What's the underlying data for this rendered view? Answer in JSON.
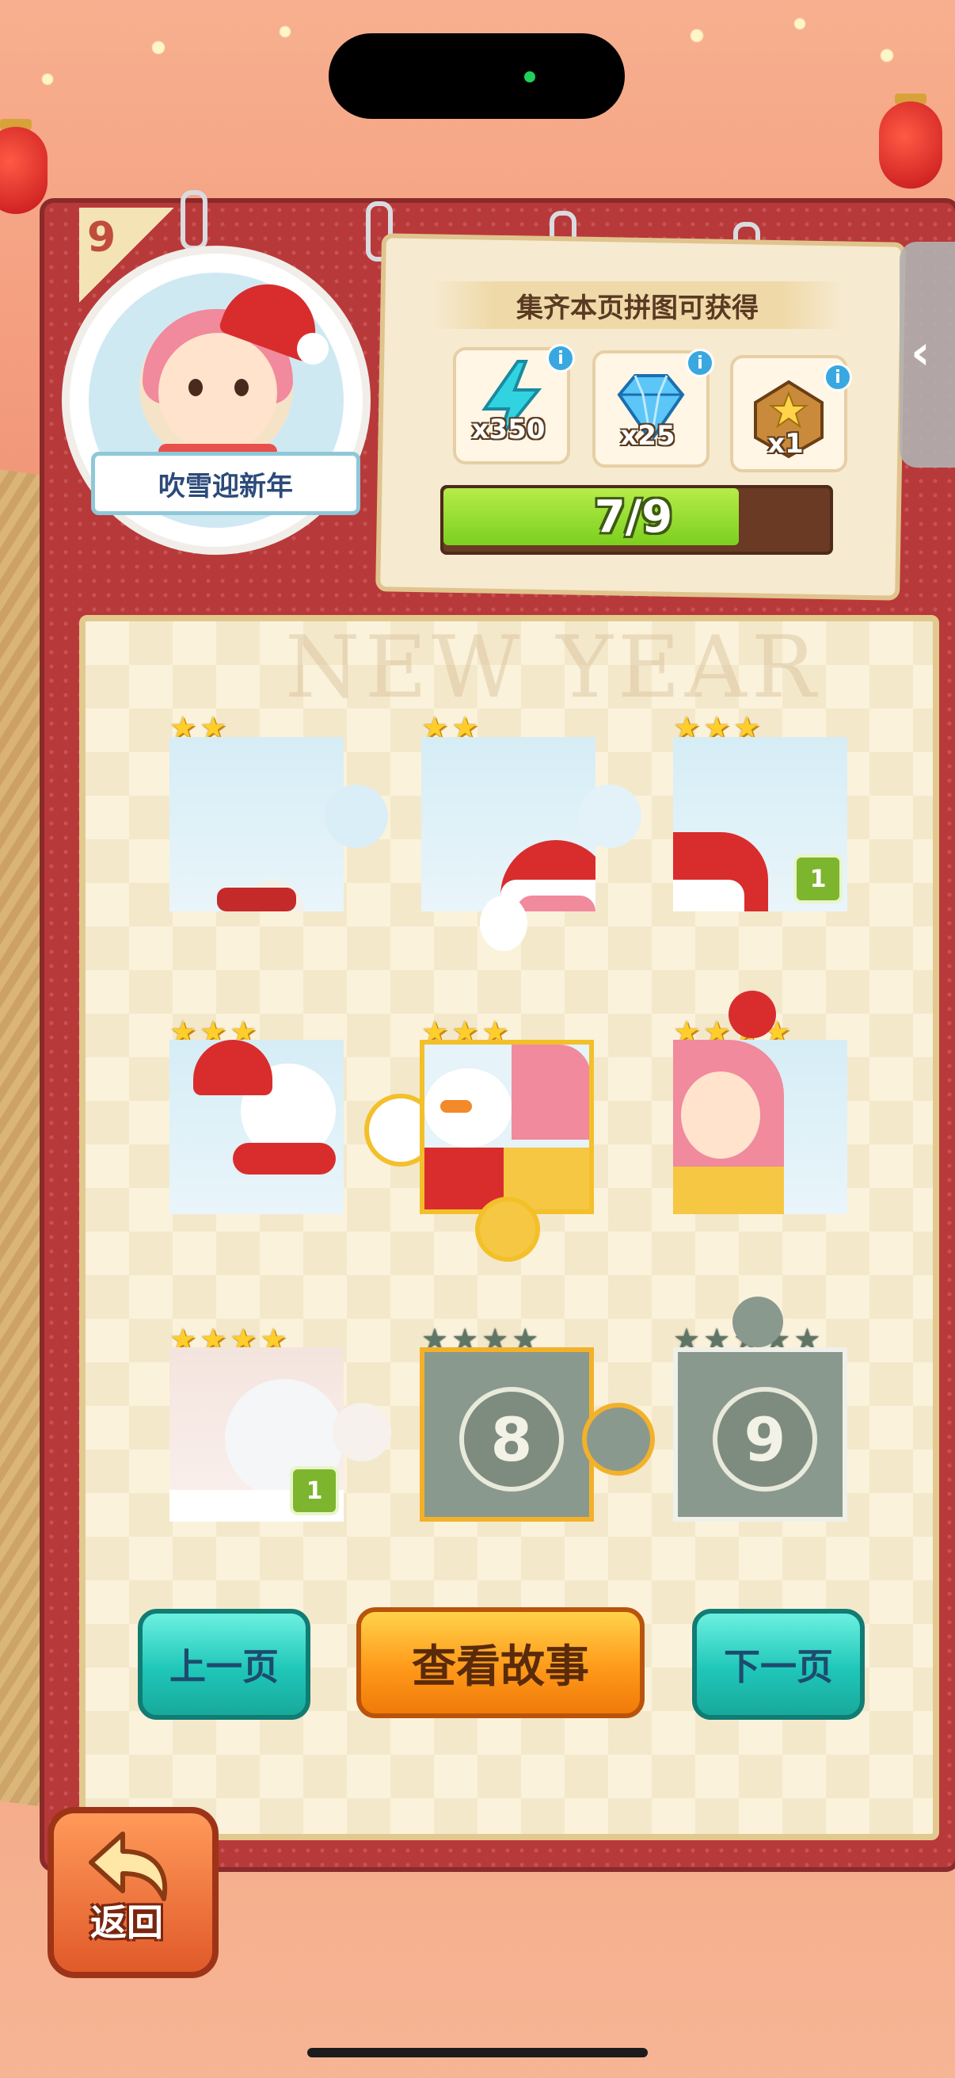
{
  "page_number": "9",
  "badge": {
    "title": "吹雪迎新年"
  },
  "reward_panel": {
    "title": "集齐本页拼图可获得",
    "rewards": [
      {
        "icon": "lightning-icon",
        "qty": "x350"
      },
      {
        "icon": "diamond-icon",
        "qty": "x25"
      },
      {
        "icon": "treasure-chest-icon",
        "qty": "x1"
      }
    ],
    "info_label": "i",
    "progress_text": "7/9",
    "progress_fraction": 0.7778
  },
  "watermark": "NEW YEAR",
  "pieces": [
    {
      "stars": 2,
      "max_stars": 2,
      "locked": false,
      "badge": ""
    },
    {
      "stars": 2,
      "max_stars": 2,
      "locked": false,
      "badge": ""
    },
    {
      "stars": 3,
      "max_stars": 3,
      "locked": false,
      "badge": "1"
    },
    {
      "stars": 3,
      "max_stars": 3,
      "locked": false,
      "badge": ""
    },
    {
      "stars": 3,
      "max_stars": 3,
      "locked": false,
      "badge": ""
    },
    {
      "stars": 4,
      "max_stars": 4,
      "locked": false,
      "badge": ""
    },
    {
      "stars": 4,
      "max_stars": 4,
      "locked": false,
      "badge": "1"
    },
    {
      "stars": 0,
      "max_stars": 4,
      "locked": true,
      "number": "8"
    },
    {
      "stars": 0,
      "max_stars": 5,
      "locked": true,
      "number": "9"
    }
  ],
  "buttons": {
    "prev": "上一页",
    "story": "查看故事",
    "next": "下一页",
    "back": "返回"
  },
  "colors": {
    "board_red": "#b8393a",
    "star_gold": "#ffce2a",
    "teal_button": "#1fc7b9",
    "orange_button": "#ff9a1a",
    "progress_green": "#7ccf1f"
  }
}
